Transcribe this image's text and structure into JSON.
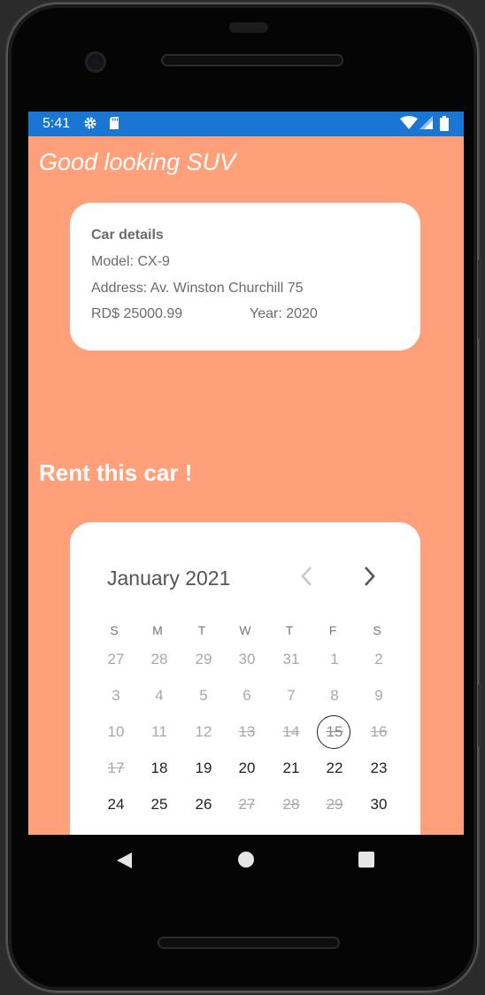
{
  "status_bar": {
    "time": "5:41",
    "settings_icon": "gear-icon",
    "sd_icon": "sd-card-icon",
    "wifi_icon": "wifi-icon",
    "signal_icon": "signal-icon",
    "battery_icon": "battery-icon"
  },
  "app": {
    "title": "Good looking SUV"
  },
  "car_details": {
    "heading": "Car details",
    "model": "Model: CX-9",
    "address": "Address: Av. Winston Churchill 75",
    "price": "RD$ 25000.99",
    "year": "Year: 2020"
  },
  "rent": {
    "title": "Rent this car !"
  },
  "calendar": {
    "month_label": "January 2021",
    "prev_icon": "chevron-left-icon",
    "next_icon": "chevron-right-icon",
    "weekdays": [
      "S",
      "M",
      "T",
      "W",
      "T",
      "F",
      "S"
    ],
    "weeks": [
      [
        "27",
        "28",
        "29",
        "30",
        "31",
        "1",
        "2"
      ],
      [
        "3",
        "4",
        "5",
        "6",
        "7",
        "8",
        "9"
      ],
      [
        "10",
        "11",
        "12",
        "13",
        "14",
        "15",
        "16"
      ],
      [
        "17",
        "18",
        "19",
        "20",
        "21",
        "22",
        "23"
      ],
      [
        "24",
        "25",
        "26",
        "27",
        "28",
        "29",
        "30"
      ]
    ]
  },
  "nav_bar": {
    "back_icon": "back-triangle-icon",
    "home_icon": "home-circle-icon",
    "recents_icon": "recents-square-icon"
  }
}
